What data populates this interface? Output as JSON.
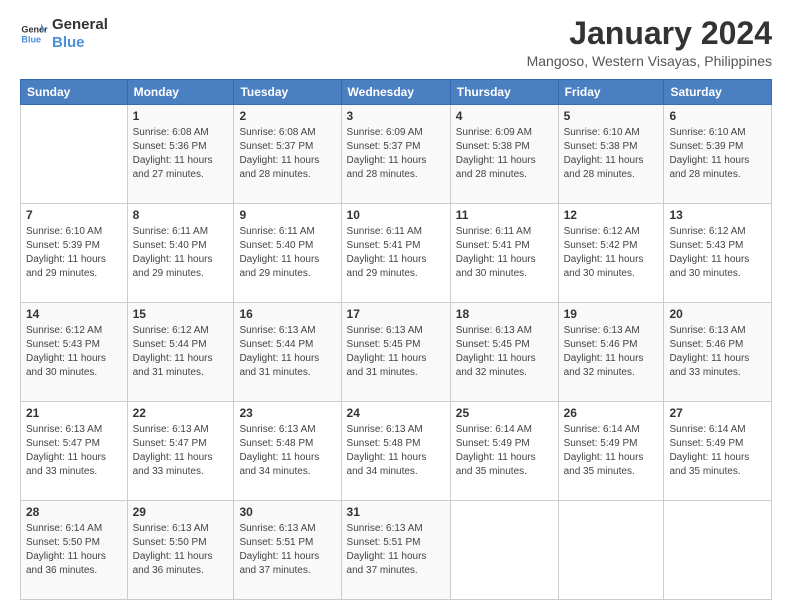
{
  "logo": {
    "line1": "General",
    "line2": "Blue"
  },
  "header": {
    "title": "January 2024",
    "subtitle": "Mangoso, Western Visayas, Philippines"
  },
  "weekdays": [
    "Sunday",
    "Monday",
    "Tuesday",
    "Wednesday",
    "Thursday",
    "Friday",
    "Saturday"
  ],
  "weeks": [
    [
      {
        "day": "",
        "sunrise": "",
        "sunset": "",
        "daylight": ""
      },
      {
        "day": "1",
        "sunrise": "Sunrise: 6:08 AM",
        "sunset": "Sunset: 5:36 PM",
        "daylight": "Daylight: 11 hours and 27 minutes."
      },
      {
        "day": "2",
        "sunrise": "Sunrise: 6:08 AM",
        "sunset": "Sunset: 5:37 PM",
        "daylight": "Daylight: 11 hours and 28 minutes."
      },
      {
        "day": "3",
        "sunrise": "Sunrise: 6:09 AM",
        "sunset": "Sunset: 5:37 PM",
        "daylight": "Daylight: 11 hours and 28 minutes."
      },
      {
        "day": "4",
        "sunrise": "Sunrise: 6:09 AM",
        "sunset": "Sunset: 5:38 PM",
        "daylight": "Daylight: 11 hours and 28 minutes."
      },
      {
        "day": "5",
        "sunrise": "Sunrise: 6:10 AM",
        "sunset": "Sunset: 5:38 PM",
        "daylight": "Daylight: 11 hours and 28 minutes."
      },
      {
        "day": "6",
        "sunrise": "Sunrise: 6:10 AM",
        "sunset": "Sunset: 5:39 PM",
        "daylight": "Daylight: 11 hours and 28 minutes."
      }
    ],
    [
      {
        "day": "7",
        "sunrise": "Sunrise: 6:10 AM",
        "sunset": "Sunset: 5:39 PM",
        "daylight": "Daylight: 11 hours and 29 minutes."
      },
      {
        "day": "8",
        "sunrise": "Sunrise: 6:11 AM",
        "sunset": "Sunset: 5:40 PM",
        "daylight": "Daylight: 11 hours and 29 minutes."
      },
      {
        "day": "9",
        "sunrise": "Sunrise: 6:11 AM",
        "sunset": "Sunset: 5:40 PM",
        "daylight": "Daylight: 11 hours and 29 minutes."
      },
      {
        "day": "10",
        "sunrise": "Sunrise: 6:11 AM",
        "sunset": "Sunset: 5:41 PM",
        "daylight": "Daylight: 11 hours and 29 minutes."
      },
      {
        "day": "11",
        "sunrise": "Sunrise: 6:11 AM",
        "sunset": "Sunset: 5:41 PM",
        "daylight": "Daylight: 11 hours and 30 minutes."
      },
      {
        "day": "12",
        "sunrise": "Sunrise: 6:12 AM",
        "sunset": "Sunset: 5:42 PM",
        "daylight": "Daylight: 11 hours and 30 minutes."
      },
      {
        "day": "13",
        "sunrise": "Sunrise: 6:12 AM",
        "sunset": "Sunset: 5:43 PM",
        "daylight": "Daylight: 11 hours and 30 minutes."
      }
    ],
    [
      {
        "day": "14",
        "sunrise": "Sunrise: 6:12 AM",
        "sunset": "Sunset: 5:43 PM",
        "daylight": "Daylight: 11 hours and 30 minutes."
      },
      {
        "day": "15",
        "sunrise": "Sunrise: 6:12 AM",
        "sunset": "Sunset: 5:44 PM",
        "daylight": "Daylight: 11 hours and 31 minutes."
      },
      {
        "day": "16",
        "sunrise": "Sunrise: 6:13 AM",
        "sunset": "Sunset: 5:44 PM",
        "daylight": "Daylight: 11 hours and 31 minutes."
      },
      {
        "day": "17",
        "sunrise": "Sunrise: 6:13 AM",
        "sunset": "Sunset: 5:45 PM",
        "daylight": "Daylight: 11 hours and 31 minutes."
      },
      {
        "day": "18",
        "sunrise": "Sunrise: 6:13 AM",
        "sunset": "Sunset: 5:45 PM",
        "daylight": "Daylight: 11 hours and 32 minutes."
      },
      {
        "day": "19",
        "sunrise": "Sunrise: 6:13 AM",
        "sunset": "Sunset: 5:46 PM",
        "daylight": "Daylight: 11 hours and 32 minutes."
      },
      {
        "day": "20",
        "sunrise": "Sunrise: 6:13 AM",
        "sunset": "Sunset: 5:46 PM",
        "daylight": "Daylight: 11 hours and 33 minutes."
      }
    ],
    [
      {
        "day": "21",
        "sunrise": "Sunrise: 6:13 AM",
        "sunset": "Sunset: 5:47 PM",
        "daylight": "Daylight: 11 hours and 33 minutes."
      },
      {
        "day": "22",
        "sunrise": "Sunrise: 6:13 AM",
        "sunset": "Sunset: 5:47 PM",
        "daylight": "Daylight: 11 hours and 33 minutes."
      },
      {
        "day": "23",
        "sunrise": "Sunrise: 6:13 AM",
        "sunset": "Sunset: 5:48 PM",
        "daylight": "Daylight: 11 hours and 34 minutes."
      },
      {
        "day": "24",
        "sunrise": "Sunrise: 6:13 AM",
        "sunset": "Sunset: 5:48 PM",
        "daylight": "Daylight: 11 hours and 34 minutes."
      },
      {
        "day": "25",
        "sunrise": "Sunrise: 6:14 AM",
        "sunset": "Sunset: 5:49 PM",
        "daylight": "Daylight: 11 hours and 35 minutes."
      },
      {
        "day": "26",
        "sunrise": "Sunrise: 6:14 AM",
        "sunset": "Sunset: 5:49 PM",
        "daylight": "Daylight: 11 hours and 35 minutes."
      },
      {
        "day": "27",
        "sunrise": "Sunrise: 6:14 AM",
        "sunset": "Sunset: 5:49 PM",
        "daylight": "Daylight: 11 hours and 35 minutes."
      }
    ],
    [
      {
        "day": "28",
        "sunrise": "Sunrise: 6:14 AM",
        "sunset": "Sunset: 5:50 PM",
        "daylight": "Daylight: 11 hours and 36 minutes."
      },
      {
        "day": "29",
        "sunrise": "Sunrise: 6:13 AM",
        "sunset": "Sunset: 5:50 PM",
        "daylight": "Daylight: 11 hours and 36 minutes."
      },
      {
        "day": "30",
        "sunrise": "Sunrise: 6:13 AM",
        "sunset": "Sunset: 5:51 PM",
        "daylight": "Daylight: 11 hours and 37 minutes."
      },
      {
        "day": "31",
        "sunrise": "Sunrise: 6:13 AM",
        "sunset": "Sunset: 5:51 PM",
        "daylight": "Daylight: 11 hours and 37 minutes."
      },
      {
        "day": "",
        "sunrise": "",
        "sunset": "",
        "daylight": ""
      },
      {
        "day": "",
        "sunrise": "",
        "sunset": "",
        "daylight": ""
      },
      {
        "day": "",
        "sunrise": "",
        "sunset": "",
        "daylight": ""
      }
    ]
  ]
}
